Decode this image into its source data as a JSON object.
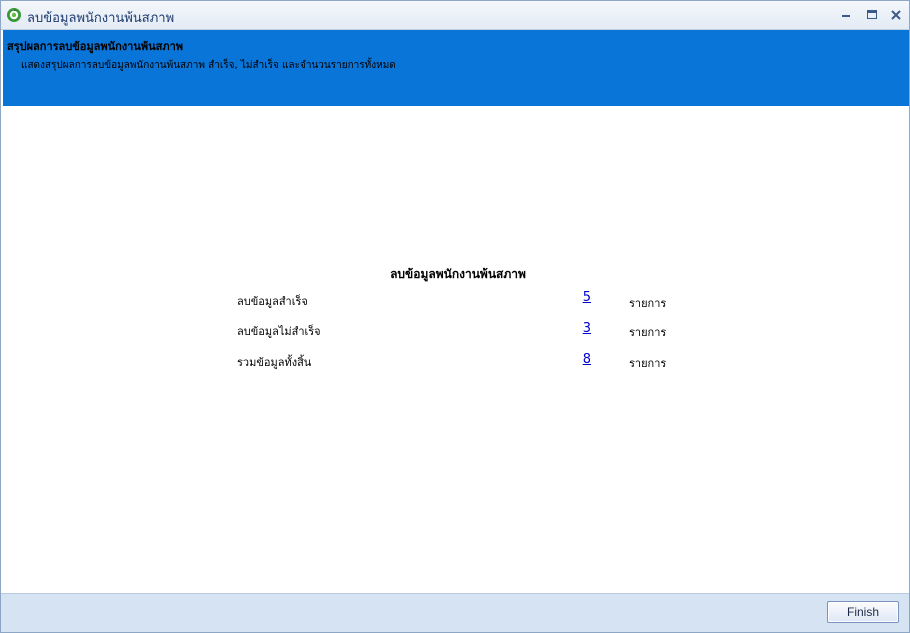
{
  "window": {
    "title": "ลบข้อมูลพนักงานพ้นสภาพ",
    "controls": [
      "minimize-icon",
      "maximize-icon",
      "close-icon"
    ]
  },
  "header": {
    "title": "สรุปผลการลบข้อมูลพนักงานพ้นสภาพ",
    "description": "แสดงสรุปผลการลบข้อมูลพนักงานพ้นสภาพ สำเร็จ, ไม่สำเร็จ และจำนวนรายการทั้งหมด",
    "background_color": "#0A75D8"
  },
  "summary": {
    "title": "ลบข้อมูลพนักงานพ้นสภาพ",
    "rows": [
      {
        "label": "ลบข้อมูลสำเร็จ",
        "count": "5",
        "unit": "รายการ"
      },
      {
        "label": "ลบข้อมูลไม่สำเร็จ",
        "count": "3",
        "unit": "รายการ"
      },
      {
        "label": "รวมข้อมูลทั้งสิ้น",
        "count": "8",
        "unit": "รายการ"
      }
    ]
  },
  "footer": {
    "finish_label": "Finish",
    "background_color": "#D6E3F3"
  }
}
